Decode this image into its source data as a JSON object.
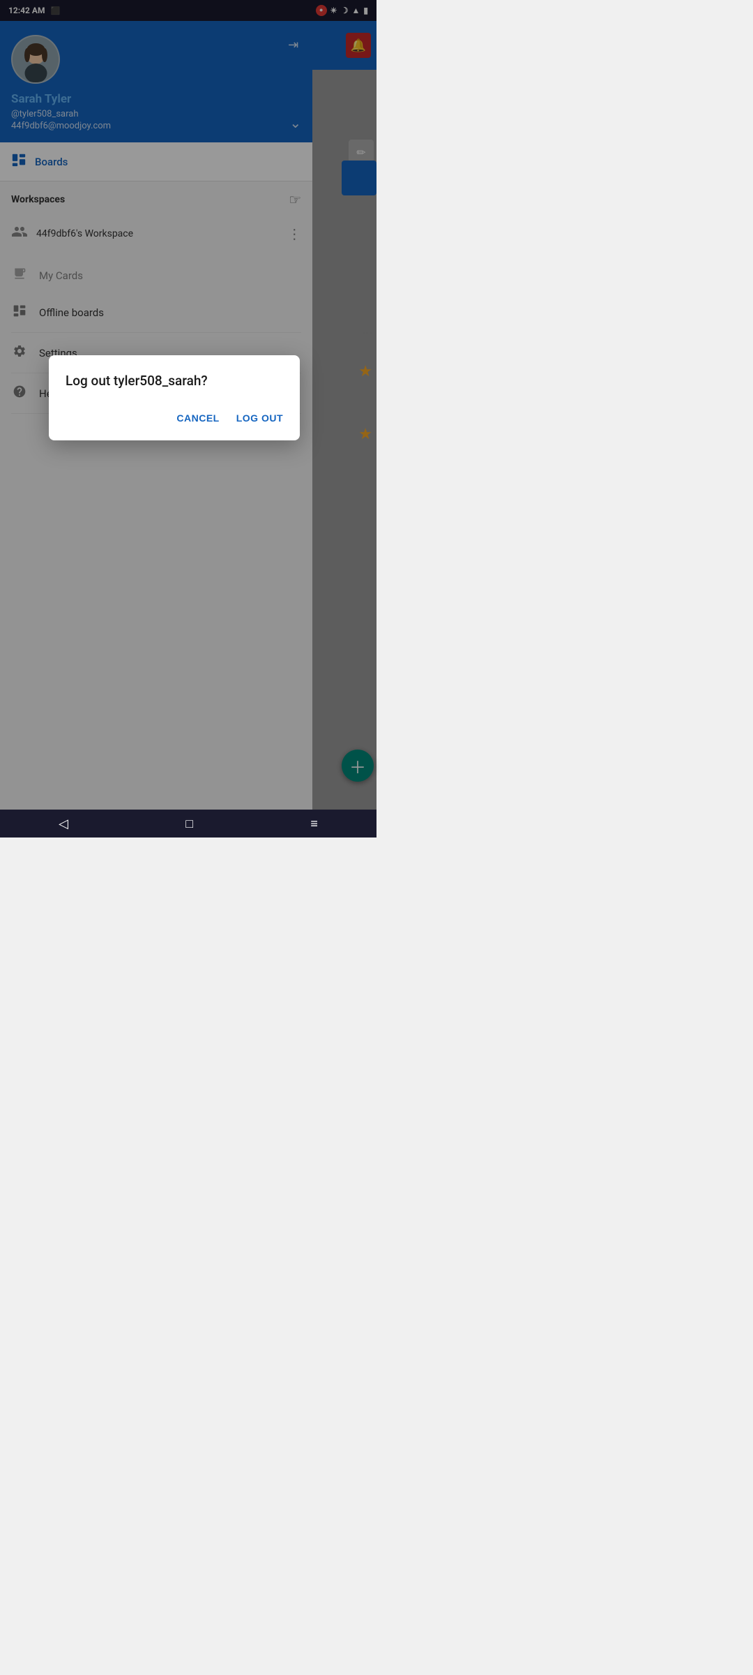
{
  "statusBar": {
    "time": "12:42 AM",
    "timeLabel": "AM"
  },
  "user": {
    "name": "Sarah Tyler",
    "handle": "@tyler508_sarah",
    "email": "44f9dbf6@moodjoy.com"
  },
  "sidebar": {
    "boardsLabel": "Boards",
    "workspacesTitle": "Workspaces",
    "workspaceName": "44f9dbf6's Workspace",
    "myCardsLabel": "My Cards",
    "offlineBoardsLabel": "Offline boards",
    "settingsLabel": "Settings",
    "helpLabel": "Help!"
  },
  "dialog": {
    "title": "Log out tyler508_sarah?",
    "cancelLabel": "CANCEL",
    "logoutLabel": "LOG OUT"
  },
  "bottomNav": {
    "backIcon": "◁",
    "homeIcon": "□",
    "menuIcon": "≡"
  }
}
